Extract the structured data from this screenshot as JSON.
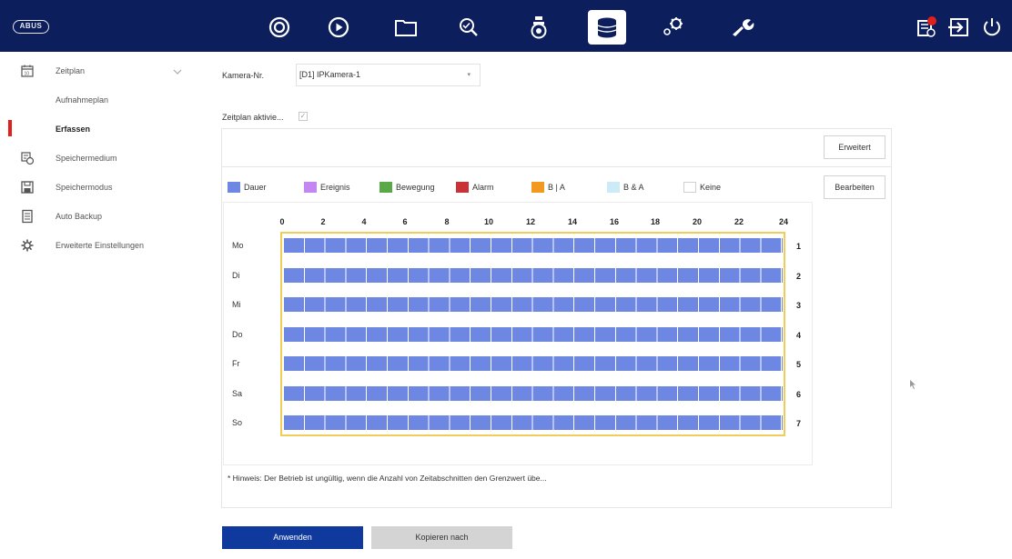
{
  "brand": {
    "logo_text": "ABUS"
  },
  "topnav": {
    "items": [
      {
        "name": "live-view-icon"
      },
      {
        "name": "playback-icon"
      },
      {
        "name": "file-management-icon"
      },
      {
        "name": "smart-search-icon"
      },
      {
        "name": "camera-icon"
      },
      {
        "name": "storage-icon",
        "active": true
      },
      {
        "name": "configuration-icon"
      },
      {
        "name": "maintenance-icon"
      }
    ],
    "right": [
      {
        "name": "alarm-icon"
      },
      {
        "name": "logout-icon"
      },
      {
        "name": "power-icon"
      }
    ]
  },
  "sidebar": {
    "items": [
      {
        "label": "Zeitplan",
        "icon": "calendar-icon"
      },
      {
        "label": "Aufnahmeplan"
      },
      {
        "label": "Erfassen",
        "active": true
      },
      {
        "label": "Speichermedium",
        "icon": "storage-device-icon"
      },
      {
        "label": "Speichermodus",
        "icon": "save-icon"
      },
      {
        "label": "Auto Backup",
        "icon": "backup-icon"
      },
      {
        "label": "Erweiterte Einstellungen",
        "icon": "gear-icon"
      }
    ]
  },
  "main": {
    "camera_label": "Kamera-Nr.",
    "camera_value": "[D1] IPKamera-1",
    "schedule_enable_label": "Zeitplan aktivie...",
    "advanced_button": "Erweitert",
    "edit_button": "Bearbeiten",
    "legend": [
      {
        "label": "Dauer",
        "color": "#6d87e2"
      },
      {
        "label": "Ereignis",
        "color": "#c486f0"
      },
      {
        "label": "Bewegung",
        "color": "#5ba848"
      },
      {
        "label": "Alarm",
        "color": "#c93236"
      },
      {
        "label": "B | A",
        "color": "#f29a1f"
      },
      {
        "label": "B & A",
        "color": "#cdeaf7"
      },
      {
        "label": "Keine",
        "color": "#ffffff"
      }
    ],
    "hours": [
      "0",
      "2",
      "4",
      "6",
      "8",
      "10",
      "12",
      "14",
      "16",
      "18",
      "20",
      "22",
      "24"
    ],
    "days": [
      "Mo",
      "Di",
      "Mi",
      "Do",
      "Fr",
      "Sa",
      "So"
    ],
    "row_numbers": [
      "1",
      "2",
      "3",
      "4",
      "5",
      "6",
      "7"
    ],
    "hint": "* Hinweis: Der Betrieb ist ungültig, wenn die Anzahl von Zeitabschnitten den Grenzwert übe...",
    "apply_button": "Anwenden",
    "copy_button": "Kopieren nach"
  }
}
